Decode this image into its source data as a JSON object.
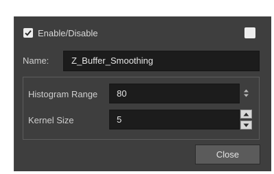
{
  "dialog": {
    "enable": {
      "label": "Enable/Disable",
      "checked": true,
      "icon": "checkmark-icon"
    },
    "color_swatch": {
      "color": "#eeeeee"
    },
    "name": {
      "label": "Name:",
      "value": "Z_Buffer_Smoothing"
    },
    "parameters": [
      {
        "label": "Histogram Range",
        "value": "80"
      },
      {
        "label": "Kernel Size",
        "value": "5"
      }
    ],
    "close_label": "Close"
  },
  "colors": {
    "dialog_bg": "#3e3e3e",
    "field_bg": "#1c1c1c",
    "text": "#cfcfcf"
  }
}
